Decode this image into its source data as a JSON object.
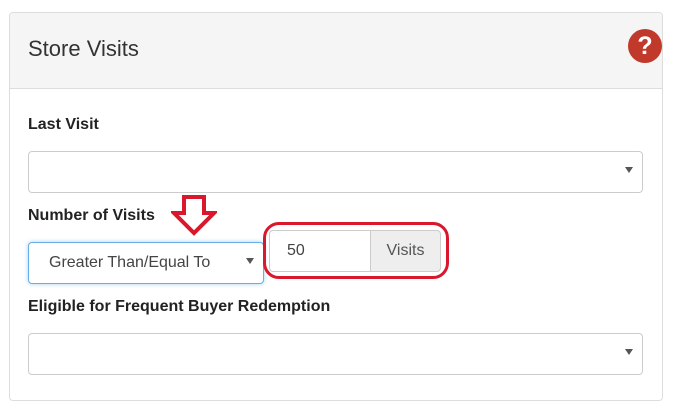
{
  "panel": {
    "title": "Store Visits",
    "help_icon": "question-circle-icon"
  },
  "fields": {
    "last_visit": {
      "label": "Last Visit",
      "value": ""
    },
    "number_of_visits": {
      "label": "Number of Visits",
      "operator_value": "Greater Than/Equal To",
      "count_value": "50",
      "unit": "Visits"
    },
    "frequent_buyer": {
      "label": "Eligible for Frequent Buyer Redemption",
      "value": ""
    }
  },
  "annotations": {
    "arrow_color": "#d9182d",
    "ring_color": "#d9182d"
  }
}
